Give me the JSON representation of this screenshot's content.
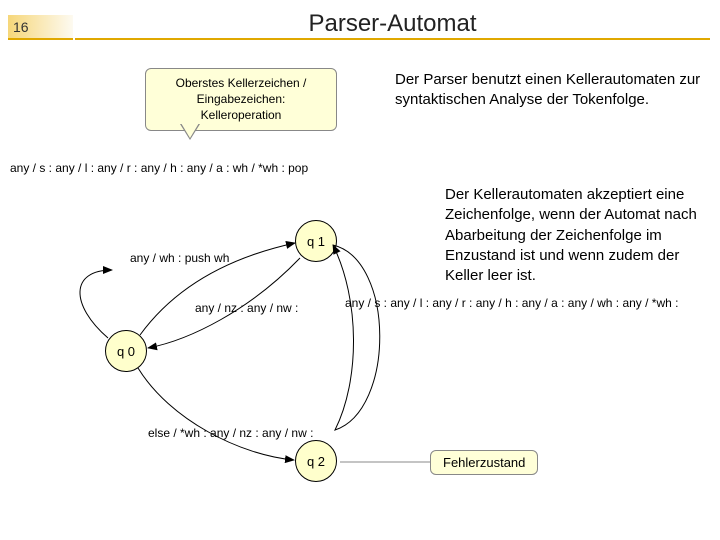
{
  "slide_number": "16",
  "title": "Parser-Automat",
  "legend": {
    "line1": "Oberstes Kellerzeichen /",
    "line2": "Eingabezeichen:",
    "line3": "Kelleroperation"
  },
  "para1": "Der Parser benutzt einen Kellerautomaten zur syntaktischen Analyse der Tokenfolge.",
  "para2": "Der Kellerautomaten akzeptiert eine Zeichenfolge, wenn der Automat nach Abarbeitung der Zeichenfolge im Enzustand ist und wenn zudem der Keller leer ist.",
  "states": {
    "q0": "q 0",
    "q1": "q 1",
    "q2": "q 2"
  },
  "transitions": {
    "q0_self": "any / s  :\nany / l  :\nany / r  :\nany / h  :\nany / a  :\nwh / *wh  : pop",
    "q0_q1": "any / wh  : push wh",
    "q1_q0": "any / nz  :\nany / nw  :",
    "q1_self": "any / s  :\nany / l  :\nany / r  :\nany / h  :\nany / a  :\nany / wh  :\nany / *wh  :",
    "q0_q2": "else / *wh  :\nany / nz  :\nany / nw  :"
  },
  "error_label": "Fehlerzustand"
}
